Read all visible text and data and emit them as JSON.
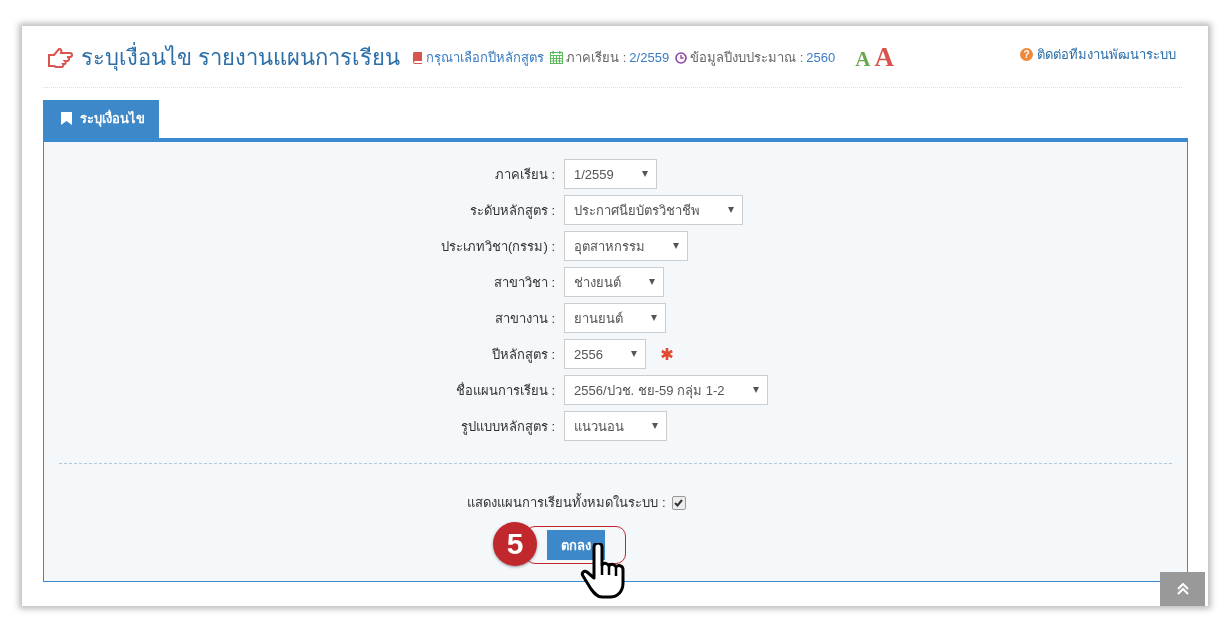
{
  "header": {
    "title": "ระบุเงื่อนไข รายงานแผนการเรียน",
    "info": [
      {
        "kind": "book",
        "label": "กรุณาเลือกปีหลักสูตร"
      },
      {
        "kind": "calendar",
        "label": "ภาคเรียน :",
        "value": "2/2559"
      },
      {
        "kind": "clock",
        "label": "ข้อมูลปีงบประมาณ :",
        "value": "2560"
      }
    ],
    "font_buttons": [
      {
        "label": "A",
        "kind": "small"
      },
      {
        "label": "A",
        "kind": "large"
      }
    ],
    "help_icon": "?",
    "help_link": "ติดต่อทีมงานพัฒนาระบบ"
  },
  "tabs": [
    {
      "label": "ระบุเงื่อนไข",
      "selected": true
    }
  ],
  "form": {
    "fields": [
      {
        "label": "ภาคเรียน :",
        "value": "1/2559",
        "required": false
      },
      {
        "label": "ระดับหลักสูตร :",
        "value": "ประกาศนียบัตรวิชาชีพ",
        "required": false
      },
      {
        "label": "ประเภทวิชา(กรรม) :",
        "value": "อุตสาหกรรม",
        "required": false
      },
      {
        "label": "สาขาวิชา :",
        "value": "ช่างยนต์",
        "required": false
      },
      {
        "label": "สาขางาน :",
        "value": "ยานยนต์",
        "required": false
      },
      {
        "label": "ปีหลักสูตร :",
        "value": "2556",
        "required": true
      },
      {
        "label": "ชื่อแผนการเรียน :",
        "value": "2556/ปวช. ชย-59 กลุ่ม 1-2",
        "required": false
      },
      {
        "label": "รูปแบบหลักสูตร :",
        "value": "แนวนอน",
        "required": false
      }
    ],
    "show_all": {
      "label": "แสดงแผนการเรียนทั้งหมดในระบบ :",
      "checked": true
    },
    "submit": "ตกลง",
    "step_badge": "5"
  }
}
